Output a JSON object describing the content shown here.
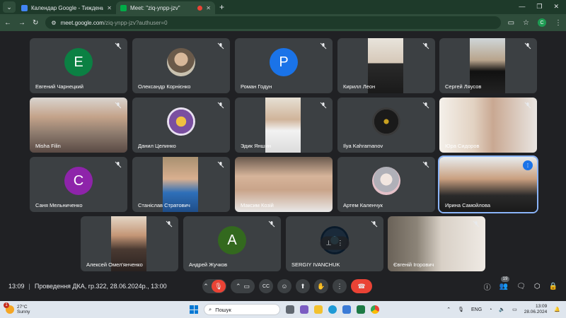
{
  "browser": {
    "tabs": [
      {
        "title": "Календар Google - Тиждень (2",
        "active": false,
        "favicon_color": "#4285f4"
      },
      {
        "title": "Meet: \"ziq-ynpp-jzv\"",
        "active": true,
        "favicon_color": "#00ac47"
      }
    ],
    "new_tab": "+",
    "url_host": "meet.google.com",
    "url_path": "/ziq-ynpp-jzv?authuser=0",
    "profile_initial": "С"
  },
  "participants": [
    {
      "name": "Евгений Чарнецкий",
      "avatar_letter": "E",
      "avatar_color": "#0b8043"
    },
    {
      "name": "Олександр Корнієнко",
      "avatar_letter": "",
      "avatar_color": ""
    },
    {
      "name": "Роман Годун",
      "avatar_letter": "P",
      "avatar_color": "#1a73e8"
    },
    {
      "name": "Кирилл Леон",
      "avatar_letter": "",
      "avatar_color": ""
    },
    {
      "name": "Сергей Ляусов",
      "avatar_letter": "",
      "avatar_color": ""
    },
    {
      "name": "Misha Filin",
      "avatar_letter": "",
      "avatar_color": ""
    },
    {
      "name": "Данил Целинко",
      "avatar_letter": "",
      "avatar_color": ""
    },
    {
      "name": "Эдик Яншин",
      "avatar_letter": "",
      "avatar_color": ""
    },
    {
      "name": "Ilya Kahramanov",
      "avatar_letter": "",
      "avatar_color": ""
    },
    {
      "name": "Юра Сидоров",
      "avatar_letter": "",
      "avatar_color": ""
    },
    {
      "name": "Саня Мельниченко",
      "avatar_letter": "C",
      "avatar_color": "#8e24aa"
    },
    {
      "name": "Станіслав Стратович",
      "avatar_letter": "",
      "avatar_color": ""
    },
    {
      "name": "Максим Козій",
      "avatar_letter": "",
      "avatar_color": ""
    },
    {
      "name": "Артем Каленчук",
      "avatar_letter": "",
      "avatar_color": ""
    },
    {
      "name": "Ирина Самойлова",
      "avatar_letter": "",
      "avatar_color": ""
    },
    {
      "name": "Алексей Омел'янченко",
      "avatar_letter": "",
      "avatar_color": ""
    },
    {
      "name": "Андрей Жучков",
      "avatar_letter": "A",
      "avatar_color": "#33691e"
    },
    {
      "name": "SERGIY IVANCHUK",
      "avatar_letter": "",
      "avatar_color": ""
    },
    {
      "name": "Євгеній Ігорович",
      "avatar_letter": "",
      "avatar_color": ""
    }
  ],
  "meeting": {
    "time": "13:09",
    "title": "Проведення ДКА, гр.322, 28.06.2024р., 13:00",
    "participant_count": "19",
    "cc_label": "CC"
  },
  "taskbar": {
    "temperature": "27°C",
    "weather": "Sunny",
    "weather_badge": "1",
    "search_placeholder": "Пошук",
    "language": "ENG",
    "clock_time": "13:09",
    "clock_date": "28.06.2024"
  }
}
